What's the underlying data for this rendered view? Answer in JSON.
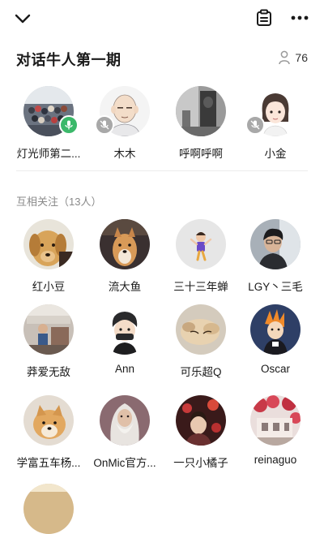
{
  "header": {
    "room_title": "对话牛人第一期",
    "audience_count": "76"
  },
  "speakers": [
    {
      "name": "灯光师第二...",
      "mic": "on",
      "avatar": "group-photo"
    },
    {
      "name": "木木",
      "mic": "muted",
      "avatar": "cartoon-bald-man"
    },
    {
      "name": "呼啊呼啊",
      "mic": "none",
      "avatar": "grayscale-figure"
    },
    {
      "name": "小金",
      "mic": "muted",
      "avatar": "cartoon-girl"
    }
  ],
  "mutual_follow": {
    "label": "互相关注（13人）",
    "people": [
      {
        "name": "红小豆"
      },
      {
        "name": "流大鱼"
      },
      {
        "name": "三十三年蝉"
      },
      {
        "name": "LGY丶三毛"
      },
      {
        "name": "莽爱无敌"
      },
      {
        "name": "Ann"
      },
      {
        "name": "可乐超Q"
      },
      {
        "name": "Oscar"
      },
      {
        "name": "学富五车杨..."
      },
      {
        "name": "OnMic官方..."
      },
      {
        "name": "一只小橘子"
      },
      {
        "name": "reinaguo"
      }
    ]
  },
  "icons": {
    "back": "chevron-down-icon",
    "note": "notepad-icon",
    "more": "more-dots-icon",
    "audience": "person-outline-icon"
  },
  "colors": {
    "mic_on": "#3bb86a",
    "mic_muted": "#a8a8a8",
    "secondary_text": "#8a8a8a"
  }
}
